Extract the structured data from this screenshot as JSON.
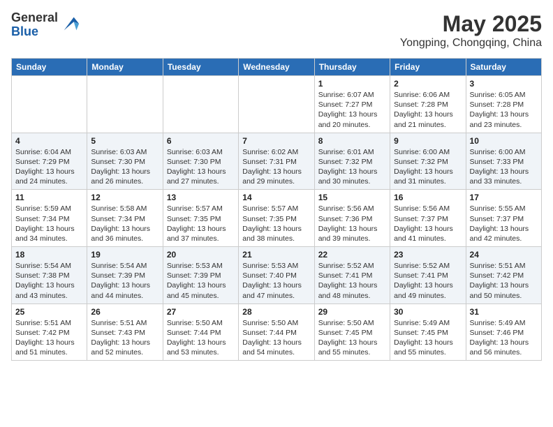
{
  "logo": {
    "general": "General",
    "blue": "Blue"
  },
  "title": {
    "month_year": "May 2025",
    "location": "Yongping, Chongqing, China"
  },
  "headers": [
    "Sunday",
    "Monday",
    "Tuesday",
    "Wednesday",
    "Thursday",
    "Friday",
    "Saturday"
  ],
  "weeks": [
    [
      {
        "day": "",
        "info": ""
      },
      {
        "day": "",
        "info": ""
      },
      {
        "day": "",
        "info": ""
      },
      {
        "day": "",
        "info": ""
      },
      {
        "day": "1",
        "info": "Sunrise: 6:07 AM\nSunset: 7:27 PM\nDaylight: 13 hours\nand 20 minutes."
      },
      {
        "day": "2",
        "info": "Sunrise: 6:06 AM\nSunset: 7:28 PM\nDaylight: 13 hours\nand 21 minutes."
      },
      {
        "day": "3",
        "info": "Sunrise: 6:05 AM\nSunset: 7:28 PM\nDaylight: 13 hours\nand 23 minutes."
      }
    ],
    [
      {
        "day": "4",
        "info": "Sunrise: 6:04 AM\nSunset: 7:29 PM\nDaylight: 13 hours\nand 24 minutes."
      },
      {
        "day": "5",
        "info": "Sunrise: 6:03 AM\nSunset: 7:30 PM\nDaylight: 13 hours\nand 26 minutes."
      },
      {
        "day": "6",
        "info": "Sunrise: 6:03 AM\nSunset: 7:30 PM\nDaylight: 13 hours\nand 27 minutes."
      },
      {
        "day": "7",
        "info": "Sunrise: 6:02 AM\nSunset: 7:31 PM\nDaylight: 13 hours\nand 29 minutes."
      },
      {
        "day": "8",
        "info": "Sunrise: 6:01 AM\nSunset: 7:32 PM\nDaylight: 13 hours\nand 30 minutes."
      },
      {
        "day": "9",
        "info": "Sunrise: 6:00 AM\nSunset: 7:32 PM\nDaylight: 13 hours\nand 31 minutes."
      },
      {
        "day": "10",
        "info": "Sunrise: 6:00 AM\nSunset: 7:33 PM\nDaylight: 13 hours\nand 33 minutes."
      }
    ],
    [
      {
        "day": "11",
        "info": "Sunrise: 5:59 AM\nSunset: 7:34 PM\nDaylight: 13 hours\nand 34 minutes."
      },
      {
        "day": "12",
        "info": "Sunrise: 5:58 AM\nSunset: 7:34 PM\nDaylight: 13 hours\nand 36 minutes."
      },
      {
        "day": "13",
        "info": "Sunrise: 5:57 AM\nSunset: 7:35 PM\nDaylight: 13 hours\nand 37 minutes."
      },
      {
        "day": "14",
        "info": "Sunrise: 5:57 AM\nSunset: 7:35 PM\nDaylight: 13 hours\nand 38 minutes."
      },
      {
        "day": "15",
        "info": "Sunrise: 5:56 AM\nSunset: 7:36 PM\nDaylight: 13 hours\nand 39 minutes."
      },
      {
        "day": "16",
        "info": "Sunrise: 5:56 AM\nSunset: 7:37 PM\nDaylight: 13 hours\nand 41 minutes."
      },
      {
        "day": "17",
        "info": "Sunrise: 5:55 AM\nSunset: 7:37 PM\nDaylight: 13 hours\nand 42 minutes."
      }
    ],
    [
      {
        "day": "18",
        "info": "Sunrise: 5:54 AM\nSunset: 7:38 PM\nDaylight: 13 hours\nand 43 minutes."
      },
      {
        "day": "19",
        "info": "Sunrise: 5:54 AM\nSunset: 7:39 PM\nDaylight: 13 hours\nand 44 minutes."
      },
      {
        "day": "20",
        "info": "Sunrise: 5:53 AM\nSunset: 7:39 PM\nDaylight: 13 hours\nand 45 minutes."
      },
      {
        "day": "21",
        "info": "Sunrise: 5:53 AM\nSunset: 7:40 PM\nDaylight: 13 hours\nand 47 minutes."
      },
      {
        "day": "22",
        "info": "Sunrise: 5:52 AM\nSunset: 7:41 PM\nDaylight: 13 hours\nand 48 minutes."
      },
      {
        "day": "23",
        "info": "Sunrise: 5:52 AM\nSunset: 7:41 PM\nDaylight: 13 hours\nand 49 minutes."
      },
      {
        "day": "24",
        "info": "Sunrise: 5:51 AM\nSunset: 7:42 PM\nDaylight: 13 hours\nand 50 minutes."
      }
    ],
    [
      {
        "day": "25",
        "info": "Sunrise: 5:51 AM\nSunset: 7:42 PM\nDaylight: 13 hours\nand 51 minutes."
      },
      {
        "day": "26",
        "info": "Sunrise: 5:51 AM\nSunset: 7:43 PM\nDaylight: 13 hours\nand 52 minutes."
      },
      {
        "day": "27",
        "info": "Sunrise: 5:50 AM\nSunset: 7:44 PM\nDaylight: 13 hours\nand 53 minutes."
      },
      {
        "day": "28",
        "info": "Sunrise: 5:50 AM\nSunset: 7:44 PM\nDaylight: 13 hours\nand 54 minutes."
      },
      {
        "day": "29",
        "info": "Sunrise: 5:50 AM\nSunset: 7:45 PM\nDaylight: 13 hours\nand 55 minutes."
      },
      {
        "day": "30",
        "info": "Sunrise: 5:49 AM\nSunset: 7:45 PM\nDaylight: 13 hours\nand 55 minutes."
      },
      {
        "day": "31",
        "info": "Sunrise: 5:49 AM\nSunset: 7:46 PM\nDaylight: 13 hours\nand 56 minutes."
      }
    ]
  ]
}
